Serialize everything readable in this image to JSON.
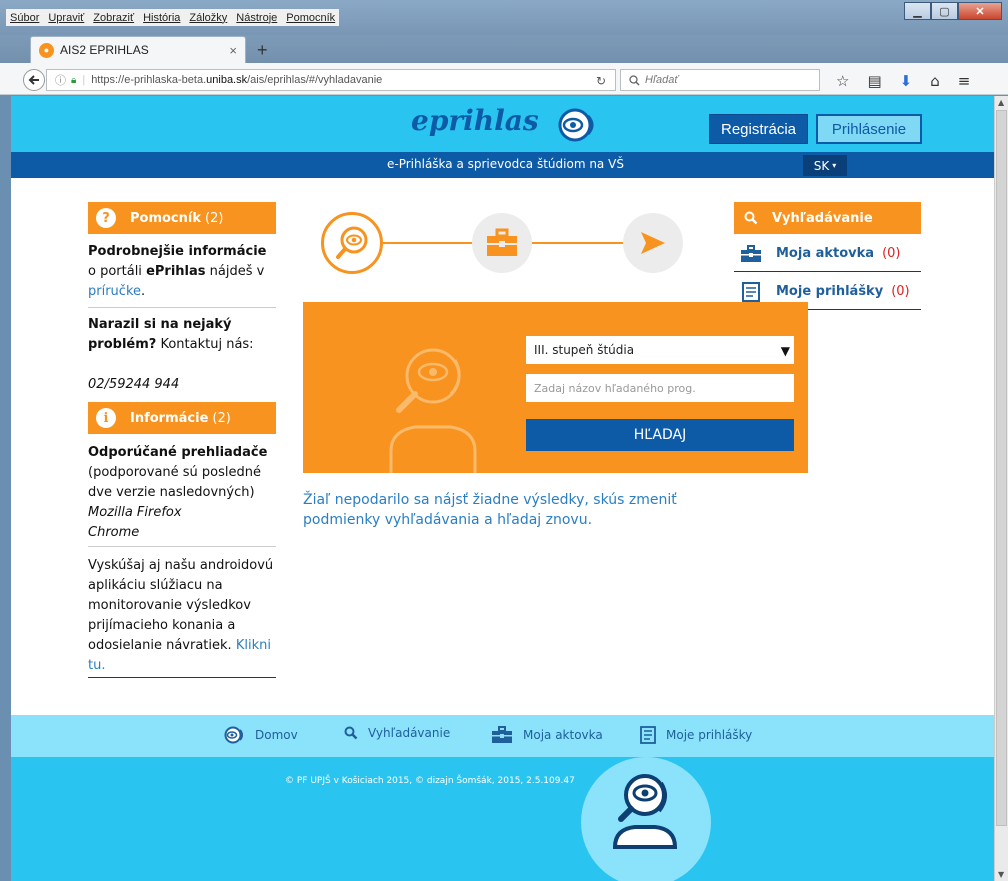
{
  "browser": {
    "menu": [
      "Súbor",
      "Upraviť",
      "Zobraziť",
      "História",
      "Záložky",
      "Nástroje",
      "Pomocník"
    ],
    "tab_title": "AIS2 EPRIHLAS",
    "tab_close": "×",
    "new_tab": "+",
    "url_prefix": "https://e-prihlaska-beta.",
    "url_domain": "uniba.sk",
    "url_suffix": "/ais/eprihlas/#/vyhladavanie",
    "search_placeholder": "Hľadať"
  },
  "header": {
    "logo": "eprihlas",
    "register": "Registrácia",
    "login": "Prihlásenie",
    "tagline": "e-Prihláška a sprievodca štúdiom na VŠ",
    "lang": "SK"
  },
  "sidebar": {
    "help_title": "Pomocník",
    "help_count": "(2)",
    "help_text_bold": "Podrobnejšie informácie",
    "help_text_1": " o portáli ",
    "help_text_brand": "ePrihlas",
    "help_text_2": " nájdeš v ",
    "help_link": "príručke",
    "help_text_end": ".",
    "problem_bold": "Narazil si na nejaký problém?",
    "problem_text": " Kontaktuj nás:",
    "phone": "02/59244 944",
    "info_title": "Informácie",
    "info_count": "(2)",
    "browsers_bold": "Odporúčané prehliadače",
    "browsers_text": "(podporované sú posledné dve verzie nasledovných)",
    "browser_1": "Mozilla Firefox",
    "browser_2": "Chrome",
    "app_text": "Vyskúšaj aj našu androidovú aplikáciu slúžiacu na monitorovanie výsledkov prijímacieho konania a odosielanie návratiek.",
    "app_link": "Klikni tu."
  },
  "right_nav": {
    "search": "Vyhľadávanie",
    "bag": "Moja aktovka",
    "bag_count": "(0)",
    "apps": "Moje prihlášky",
    "apps_count": "(0)"
  },
  "search": {
    "select_value": "III. stupeň štúdia",
    "input_placeholder": "Zadaj názov hľadaného prog.",
    "button": "HĽADAJ"
  },
  "no_results": "Žiaľ nepodarilo sa nájsť žiadne výsledky, skús zmeniť podmienky vyhľadávania a hľadaj znovu.",
  "footer": {
    "nav_home": "Domov",
    "nav_search": "Vyhľadávanie",
    "nav_bag": "Moja aktovka",
    "nav_apps": "Moje prihlášky",
    "copyright": "© PF UPJŠ v Košiciach 2015, © dizajn Šomšák, 2015, 2.5.109.47"
  },
  "colors": {
    "orange": "#f7931e",
    "blue": "#0d5aa7",
    "cyan": "#29c5f0",
    "light_cyan": "#8be2fb"
  }
}
